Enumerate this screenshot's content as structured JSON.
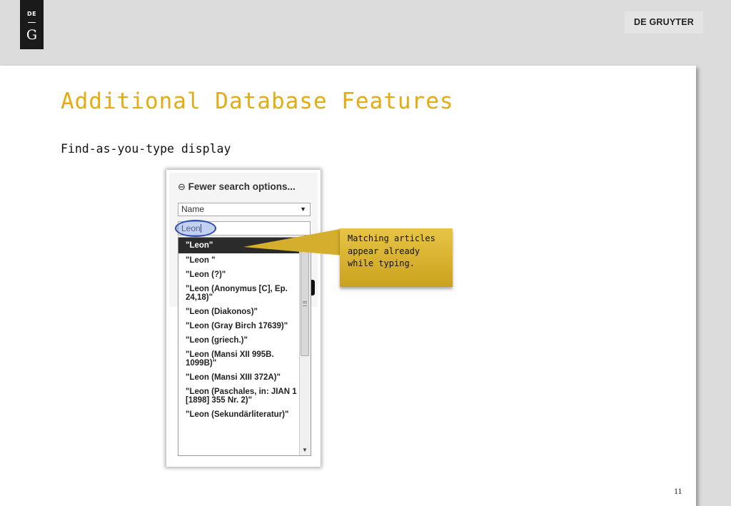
{
  "header": {
    "logo": {
      "top": "DE",
      "bottom": "G"
    },
    "brand": "DE GRUYTER"
  },
  "slide": {
    "title": "Additional Database Features",
    "subtitle": "Find-as-you-type display",
    "page_number": "11"
  },
  "screenshot": {
    "toggle_icon": "⊖",
    "toggle_label": "Fewer search options...",
    "field_select": "Name",
    "search_value": "Leon",
    "suggestions": [
      "\"Leon\"",
      "\"Leon \"",
      "\"Leon (?)\"",
      "\"Leon (Anonymus [C], Ep. 24,18)\"",
      "\"Leon (Diakonos)\"",
      "\"Leon (Gray Birch 17639)\"",
      "\"Leon (griech.)\"",
      "\"Leon (Mansi XII 995B. 1099B)\"",
      "\"Leon (Mansi XIII 372A)\"",
      "\"Leon (Paschales, in: JIAN 1 [1898] 355 Nr. 2)\"",
      "\"Leon (Sekundärliteratur)\""
    ],
    "active_index": 0
  },
  "callout": {
    "text": "Matching articles appear already while typing."
  },
  "colors": {
    "title": "#e5ac12",
    "callout": "#d4ae2c",
    "highlight_ring": "#2a4cb3"
  }
}
